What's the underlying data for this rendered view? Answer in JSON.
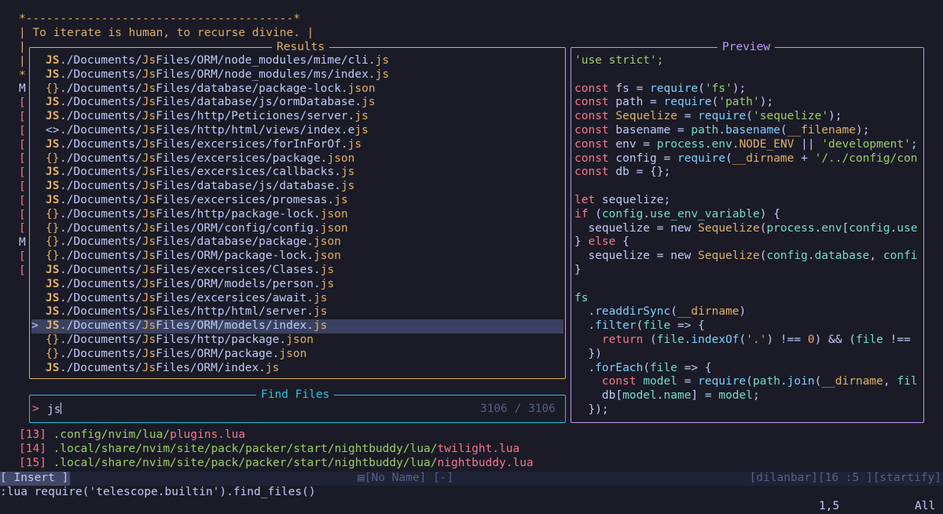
{
  "background_lines": {
    "dash_line": "*---------------------------------------*",
    "quote_line": "| To iterate is human, to recurse divine. |",
    "left_markers": [
      "|",
      "|",
      "*",
      "M",
      "[",
      "[",
      "[",
      "[",
      "[",
      "[",
      "[",
      "[",
      "[",
      "[",
      "M",
      "[",
      "["
    ],
    "recent_files": [
      {
        "index": "[13]",
        "path": ".config/nvim/lua/",
        "file": "plugins.lua"
      },
      {
        "index": "[14]",
        "path": ".local/share/nvim/site/pack/packer/start/nightbuddy/lua/",
        "file": "twilight.lua"
      },
      {
        "index": "[15]",
        "path": ".local/share/nvim/site/pack/packer/start/nightbuddy/lua/",
        "file": "nightbuddy.lua"
      }
    ]
  },
  "results": {
    "title": "Results",
    "selected_index": 19,
    "caret": ">",
    "items": [
      {
        "icon": "JS",
        "dir": "./Documents/",
        "match": "Js",
        "mid": "Files/ORM/node_modules/mime/cli.",
        "ext": "js"
      },
      {
        "icon": "JS",
        "dir": "./Documents/",
        "match": "Js",
        "mid": "Files/ORM/node_modules/ms/index.",
        "ext": "js"
      },
      {
        "icon": "{}",
        "dir": "./Documents/",
        "match": "Js",
        "mid": "Files/database/package-lock.",
        "ext": "json"
      },
      {
        "icon": "JS",
        "dir": "./Documents/",
        "match": "Js",
        "mid": "Files/database/js/ormDatabase.",
        "ext": "js"
      },
      {
        "icon": "JS",
        "dir": "./Documents/",
        "match": "Js",
        "mid": "Files/http/Peticiones/server.",
        "ext": "js"
      },
      {
        "icon": "<>",
        "dir": "./Documents/",
        "match": "Js",
        "mid": "Files/http/html/views/index.e",
        "ext": "js"
      },
      {
        "icon": "JS",
        "dir": "./Documents/",
        "match": "Js",
        "mid": "Files/excersices/forInForOf.",
        "ext": "js"
      },
      {
        "icon": "{}",
        "dir": "./Documents/",
        "match": "Js",
        "mid": "Files/excersices/package.",
        "ext": "json"
      },
      {
        "icon": "JS",
        "dir": "./Documents/",
        "match": "Js",
        "mid": "Files/excersices/callbacks.",
        "ext": "js"
      },
      {
        "icon": "JS",
        "dir": "./Documents/",
        "match": "Js",
        "mid": "Files/database/js/database.",
        "ext": "js"
      },
      {
        "icon": "JS",
        "dir": "./Documents/",
        "match": "Js",
        "mid": "Files/excersices/promesas.",
        "ext": "js"
      },
      {
        "icon": "{}",
        "dir": "./Documents/",
        "match": "Js",
        "mid": "Files/http/package-lock.",
        "ext": "json"
      },
      {
        "icon": "{}",
        "dir": "./Documents/",
        "match": "Js",
        "mid": "Files/ORM/config/config.",
        "ext": "json"
      },
      {
        "icon": "{}",
        "dir": "./Documents/",
        "match": "Js",
        "mid": "Files/database/package.",
        "ext": "json"
      },
      {
        "icon": "{}",
        "dir": "./Documents/",
        "match": "Js",
        "mid": "Files/ORM/package-lock.",
        "ext": "json"
      },
      {
        "icon": "JS",
        "dir": "./Documents/",
        "match": "Js",
        "mid": "Files/excersices/Clases.",
        "ext": "js"
      },
      {
        "icon": "JS",
        "dir": "./Documents/",
        "match": "Js",
        "mid": "Files/ORM/models/person.",
        "ext": "js"
      },
      {
        "icon": "JS",
        "dir": "./Documents/",
        "match": "Js",
        "mid": "Files/excersices/await.",
        "ext": "js"
      },
      {
        "icon": "JS",
        "dir": "./Documents/",
        "match": "Js",
        "mid": "Files/http/html/server.",
        "ext": "js"
      },
      {
        "icon": "JS",
        "dir": "./Documents/",
        "match": "Js",
        "mid": "Files/ORM/models/index.",
        "ext": "js"
      },
      {
        "icon": "{}",
        "dir": "./Documents/",
        "match": "Js",
        "mid": "Files/http/package.",
        "ext": "json"
      },
      {
        "icon": "{}",
        "dir": "./Documents/",
        "match": "Js",
        "mid": "Files/ORM/package.",
        "ext": "json"
      },
      {
        "icon": "JS",
        "dir": "./Documents/",
        "match": "Js",
        "mid": "Files/ORM/index.",
        "ext": "js"
      }
    ]
  },
  "preview": {
    "title": "Preview",
    "lines": [
      [
        [
          "str",
          "'use strict';"
        ]
      ],
      [],
      [
        [
          "kw",
          "const "
        ],
        [
          "plain",
          "fs = "
        ],
        [
          "fn",
          "require"
        ],
        [
          "plain",
          "("
        ],
        [
          "str",
          "'fs'"
        ],
        [
          "plain",
          ");"
        ]
      ],
      [
        [
          "kw",
          "const "
        ],
        [
          "plain",
          "path = "
        ],
        [
          "fn",
          "require"
        ],
        [
          "plain",
          "("
        ],
        [
          "str",
          "'path'"
        ],
        [
          "plain",
          ");"
        ]
      ],
      [
        [
          "kw",
          "const "
        ],
        [
          "id",
          "Sequelize"
        ],
        [
          "plain",
          " = "
        ],
        [
          "fn",
          "require"
        ],
        [
          "plain",
          "("
        ],
        [
          "str",
          "'sequelize'"
        ],
        [
          "plain",
          ");"
        ]
      ],
      [
        [
          "kw",
          "const "
        ],
        [
          "plain",
          "basename = "
        ],
        [
          "prop",
          "path"
        ],
        [
          "plain",
          "."
        ],
        [
          "fn",
          "basename"
        ],
        [
          "plain",
          "("
        ],
        [
          "id",
          "__filename"
        ],
        [
          "plain",
          ");"
        ]
      ],
      [
        [
          "kw",
          "const "
        ],
        [
          "plain",
          "env = "
        ],
        [
          "prop",
          "process"
        ],
        [
          "plain",
          "."
        ],
        [
          "prop",
          "env"
        ],
        [
          "plain",
          "."
        ],
        [
          "id",
          "NODE_ENV"
        ],
        [
          "plain",
          " || "
        ],
        [
          "str",
          "'development'"
        ],
        [
          "plain",
          ";"
        ]
      ],
      [
        [
          "kw",
          "const "
        ],
        [
          "plain",
          "config = "
        ],
        [
          "fn",
          "require"
        ],
        [
          "plain",
          "("
        ],
        [
          "id",
          "__dirname"
        ],
        [
          "plain",
          " + "
        ],
        [
          "str",
          "'/../config/con"
        ]
      ],
      [
        [
          "kw",
          "const "
        ],
        [
          "plain",
          "db = {};"
        ]
      ],
      [],
      [
        [
          "kw",
          "let "
        ],
        [
          "plain",
          "sequelize;"
        ]
      ],
      [
        [
          "kw",
          "if "
        ],
        [
          "plain",
          "("
        ],
        [
          "prop",
          "config"
        ],
        [
          "plain",
          "."
        ],
        [
          "prop",
          "use_env_variable"
        ],
        [
          "plain",
          ") {"
        ]
      ],
      [
        [
          "plain",
          "  sequelize = new "
        ],
        [
          "id",
          "Sequelize"
        ],
        [
          "plain",
          "("
        ],
        [
          "prop",
          "process"
        ],
        [
          "plain",
          "."
        ],
        [
          "prop",
          "env"
        ],
        [
          "plain",
          "["
        ],
        [
          "prop",
          "config"
        ],
        [
          "plain",
          "."
        ],
        [
          "prop",
          "use"
        ]
      ],
      [
        [
          "plain",
          "} "
        ],
        [
          "kw",
          "else "
        ],
        [
          "plain",
          "{"
        ]
      ],
      [
        [
          "plain",
          "  sequelize = new "
        ],
        [
          "id",
          "Sequelize"
        ],
        [
          "plain",
          "("
        ],
        [
          "prop",
          "config"
        ],
        [
          "plain",
          "."
        ],
        [
          "prop",
          "database"
        ],
        [
          "plain",
          ", "
        ],
        [
          "prop",
          "confi"
        ]
      ],
      [
        [
          "plain",
          "}"
        ]
      ],
      [],
      [
        [
          "prop",
          "fs"
        ]
      ],
      [
        [
          "plain",
          "  ."
        ],
        [
          "fn",
          "readdirSync"
        ],
        [
          "plain",
          "("
        ],
        [
          "id",
          "__dirname"
        ],
        [
          "plain",
          ")"
        ]
      ],
      [
        [
          "plain",
          "  ."
        ],
        [
          "fn",
          "filter"
        ],
        [
          "plain",
          "("
        ],
        [
          "prop",
          "file"
        ],
        [
          "plain",
          " => {"
        ]
      ],
      [
        [
          "kw",
          "    return "
        ],
        [
          "plain",
          "("
        ],
        [
          "prop",
          "file"
        ],
        [
          "plain",
          "."
        ],
        [
          "fn",
          "indexOf"
        ],
        [
          "plain",
          "("
        ],
        [
          "str",
          "'.'"
        ],
        [
          "plain",
          ") !== "
        ],
        [
          "num",
          "0"
        ],
        [
          "plain",
          ") && ("
        ],
        [
          "prop",
          "file"
        ],
        [
          "plain",
          " !=="
        ]
      ],
      [
        [
          "plain",
          "  })"
        ]
      ],
      [
        [
          "plain",
          "  ."
        ],
        [
          "fn",
          "forEach"
        ],
        [
          "plain",
          "("
        ],
        [
          "prop",
          "file"
        ],
        [
          "plain",
          " => {"
        ]
      ],
      [
        [
          "kw",
          "    const "
        ],
        [
          "prop",
          "model"
        ],
        [
          "plain",
          " = "
        ],
        [
          "fn",
          "require"
        ],
        [
          "plain",
          "("
        ],
        [
          "prop",
          "path"
        ],
        [
          "plain",
          "."
        ],
        [
          "fn",
          "join"
        ],
        [
          "plain",
          "("
        ],
        [
          "id",
          "__dirname"
        ],
        [
          "plain",
          ", "
        ],
        [
          "prop",
          "fil"
        ]
      ],
      [
        [
          "plain",
          "    db["
        ],
        [
          "prop",
          "model"
        ],
        [
          "plain",
          "."
        ],
        [
          "prop",
          "name"
        ],
        [
          "plain",
          "] = "
        ],
        [
          "prop",
          "model"
        ],
        [
          "plain",
          ";"
        ]
      ],
      [
        [
          "plain",
          "  });"
        ]
      ]
    ]
  },
  "prompt": {
    "title": "Find Files",
    "caret": ">",
    "query": "js",
    "count": "3106 / 3106"
  },
  "statusline": {
    "mode": "[ Insert ]",
    "buffer_icon": "file-icon",
    "buffer": "[No Name] [-]",
    "right": "[dilanbar][16 :5 ][startify]"
  },
  "cmdline": {
    "command": ":lua require('telescope.builtin').find_files()",
    "position": "1,5",
    "scroll": "All"
  },
  "colors": {
    "background": "#1a1b26",
    "results_border": "#e0af68",
    "preview_border": "#bb9af7",
    "prompt_border": "#2ac3de",
    "selection": "#3b4261",
    "accent_red": "#f7768e",
    "accent_green": "#9ece6a"
  }
}
